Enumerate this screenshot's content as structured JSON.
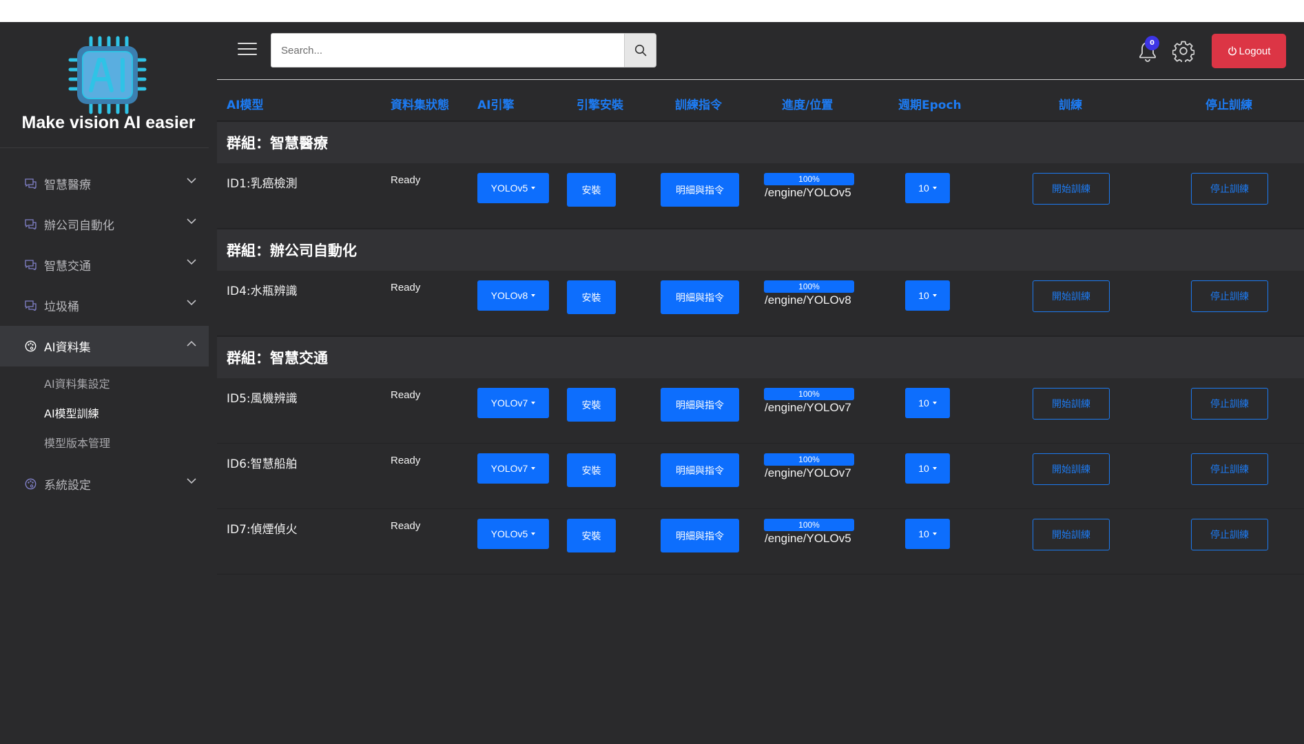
{
  "brand": {
    "tagline": "Make vision AI easier",
    "logo_letters": "AI"
  },
  "sidebar": {
    "items": [
      {
        "label": "智慧醫療",
        "icon": "chat-icon"
      },
      {
        "label": "辦公司自動化",
        "icon": "chat-icon"
      },
      {
        "label": "智慧交通",
        "icon": "chat-icon"
      },
      {
        "label": "垃圾桶",
        "icon": "chat-icon"
      },
      {
        "label": "AI資料集",
        "icon": "palette-icon",
        "expanded": true
      },
      {
        "label": "系統設定",
        "icon": "palette-icon"
      }
    ],
    "subitems": [
      {
        "label": "AI資料集設定"
      },
      {
        "label": "AI模型訓練",
        "current": true
      },
      {
        "label": "模型版本管理"
      }
    ]
  },
  "header": {
    "search_placeholder": "Search...",
    "notification_count": "0",
    "logout_label": "Logout"
  },
  "table": {
    "columns": [
      "AI模型",
      "資料集狀態",
      "AI引擎",
      "引擎安裝",
      "訓練指令",
      "進度/位置",
      "週期Epoch",
      "訓練",
      "停止訓練"
    ],
    "groups": [
      {
        "title": "群組：智慧醫療",
        "rows": [
          {
            "name": "ID1:乳癌檢測",
            "status": "Ready",
            "engine": "YOLOv5",
            "install": "安裝",
            "detail": "明細與指令",
            "progress": "100%",
            "progress_value": 100,
            "path": "/engine/YOLOv5",
            "epoch": "10",
            "start": "開始訓練",
            "stop": "停止訓練"
          }
        ]
      },
      {
        "title": "群組：辦公司自動化",
        "rows": [
          {
            "name": "ID4:水瓶辨識",
            "status": "Ready",
            "engine": "YOLOv8",
            "install": "安裝",
            "detail": "明細與指令",
            "progress": "100%",
            "progress_value": 100,
            "path": "/engine/YOLOv8",
            "epoch": "10",
            "start": "開始訓練",
            "stop": "停止訓練"
          }
        ]
      },
      {
        "title": "群組：智慧交通",
        "rows": [
          {
            "name": "ID5:風機辨識",
            "status": "Ready",
            "engine": "YOLOv7",
            "install": "安裝",
            "detail": "明細與指令",
            "progress": "100%",
            "progress_value": 100,
            "path": "/engine/YOLOv7",
            "epoch": "10",
            "start": "開始訓練",
            "stop": "停止訓練"
          },
          {
            "name": "ID6:智慧船舶",
            "status": "Ready",
            "engine": "YOLOv7",
            "install": "安裝",
            "detail": "明細與指令",
            "progress": "100%",
            "progress_value": 100,
            "path": "/engine/YOLOv7",
            "epoch": "10",
            "start": "開始訓練",
            "stop": "停止訓練"
          },
          {
            "name": "ID7:偵煙偵火",
            "status": "Ready",
            "engine": "YOLOv5",
            "install": "安裝",
            "detail": "明細與指令",
            "progress": "100%",
            "progress_value": 100,
            "path": "/engine/YOLOv5",
            "epoch": "10",
            "start": "開始訓練",
            "stop": "停止訓練"
          }
        ]
      }
    ]
  },
  "colors": {
    "accent": "#0d6efd",
    "header_text": "#1d7bf2",
    "logout": "#dc3545",
    "badge": "#3d35e6",
    "background": "#2a2a2c",
    "logo_cyan": "#2fc3e6"
  }
}
